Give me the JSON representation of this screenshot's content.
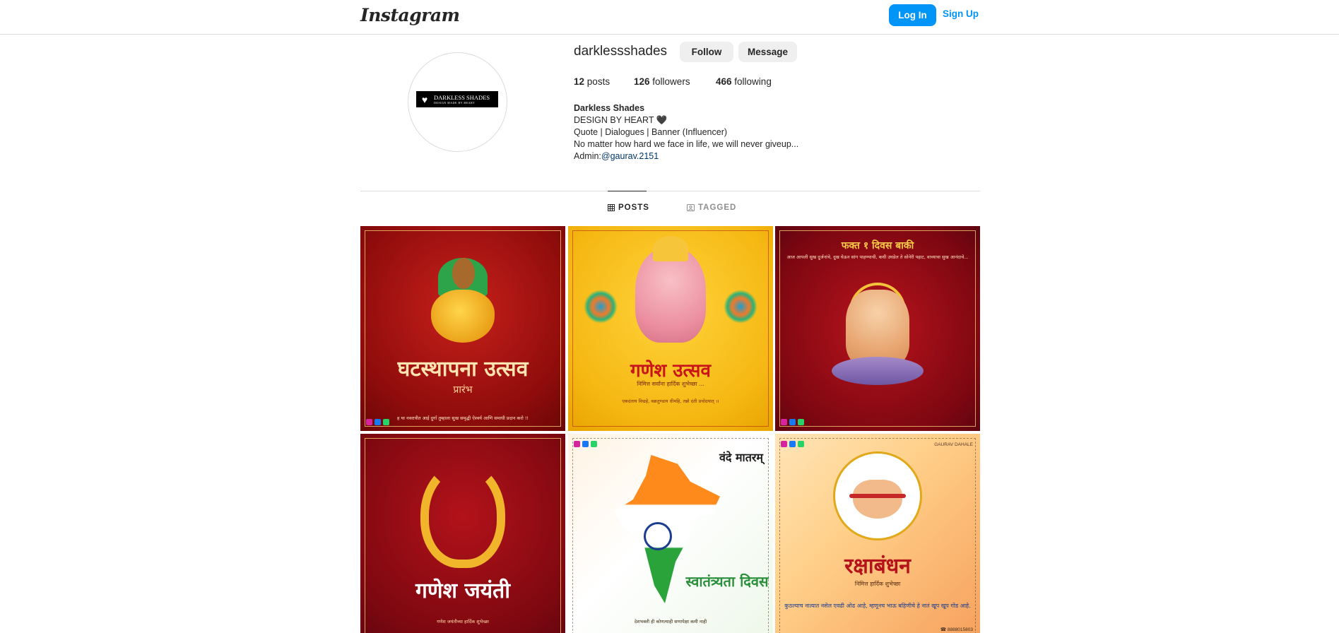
{
  "header": {
    "logo": "Instagram",
    "login_label": "Log In",
    "signup_label": "Sign Up"
  },
  "profile": {
    "username": "darklessshades",
    "follow_label": "Follow",
    "message_label": "Message",
    "stats": {
      "posts_count": "12",
      "posts_label": "posts",
      "followers_count": "126",
      "followers_label": "followers",
      "following_count": "466",
      "following_label": "following"
    },
    "bio": {
      "name": "Darkless Shades",
      "line1": "DESIGN BY HEART 🖤",
      "line2": "Quote | Dialogues | Banner (Influencer)",
      "line3": "No matter how hard we face in life, we will never giveup...",
      "admin_prefix": "Admin:",
      "admin_handle": "@gaurav.2151"
    },
    "avatar": {
      "brand": "DARKLESS SHADES",
      "tagline": "DESIGN MADE BY HEART"
    }
  },
  "tabs": [
    {
      "label": "POSTS",
      "icon": "grid-icon",
      "active": true
    },
    {
      "label": "TAGGED",
      "icon": "tag-icon",
      "active": false
    }
  ],
  "posts": [
    {
      "title": "घटस्थापना उत्सव",
      "subtitle": "प्रारंभ",
      "caption": "ह या नवरात्रीत आई दुर्गा तुम्हाला सुख समृद्धी ऐश्वर्य आणि समाधी प्रदान करो !!"
    },
    {
      "title": "गणेश उत्सव",
      "subtitle": "निमित्त सर्वांना हार्दिक शुभेच्छा ...",
      "caption": "एकदंताय विद्महे, वक्रतुण्डाय धीमहि, तन्नो दंती प्रचोदयात् ।।"
    },
    {
      "title": "फक्त १ दिवस बाकी",
      "subtitle": "",
      "caption": "आज आपली सुख दुर्जनांचे, दुख घेऊन सांग पाहण्याची, कधी उघडेल ते सोनेरी पहाट, वाच्याचा सुख आनंदाचे..."
    },
    {
      "title": "गणेश जयंती",
      "subtitle": "",
      "caption": "गणेश जयंतीच्या हार्दिक शुभेच्छा"
    },
    {
      "title": "स्वातंत्र्यता दिवस",
      "subtitle": "वंदे मातरम्",
      "caption": "देशभक्ती ही कोणत्याही सणापेक्षा कमी नाही"
    },
    {
      "title": "रक्षाबंधन",
      "subtitle": "निमित्त हार्दिक शुभेच्छा",
      "caption": "कुठल्याच नात्यात नसेल एवढी ओढ आहे, म्हणूनच भाऊ बहिणीचे हे नातं खूप खूप गोड आहे.",
      "brand": "GAURAV DAHALE",
      "phone": "8888015803"
    }
  ],
  "colors": {
    "accent": "#0095f6",
    "text": "#262626",
    "muted": "#8e8e8e",
    "link": "#00376b",
    "border": "#dbdbdb"
  }
}
